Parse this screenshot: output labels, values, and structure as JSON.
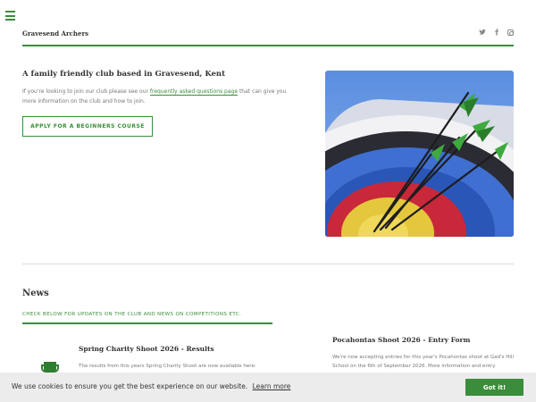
{
  "header": {
    "site_title": "Gravesend Archers",
    "social": [
      "twitter-icon",
      "facebook-icon",
      "instagram-icon"
    ]
  },
  "hero": {
    "title": "A family friendly club based in Gravesend, Kent",
    "text_before": "If you're looking to join our club please see our",
    "link_label": "frequently asked questions page",
    "text_after": "that can give you more information on the club and how to join.",
    "cta_label": "APPLY FOR A BEGINNERS COURSE"
  },
  "news": {
    "title": "News",
    "subtitle": "CHECK BELOW FOR UPDATES ON THE CLUB AND NEWS ON COMPETITIONS ETC.",
    "posts": [
      {
        "title": "Spring Charity Shoot 2026 - Results",
        "excerpt": "The results from this years Spring Charity Shoot are now available here:"
      },
      {
        "title": "Pocahontas Shoot 2026 - Entry Form",
        "excerpt": "We're now accepting entries for this year's Pocahontas shoot at Gad's Hill School on the 6th of September 2026. More information and entry"
      }
    ]
  },
  "cookie": {
    "message": "We use cookies to ensure you get the best experience on our website.",
    "learn_more": "Learn more",
    "accept": "Got it!"
  },
  "colors": {
    "accent": "#3a8d3a",
    "cookie_bg": "#ececec"
  }
}
